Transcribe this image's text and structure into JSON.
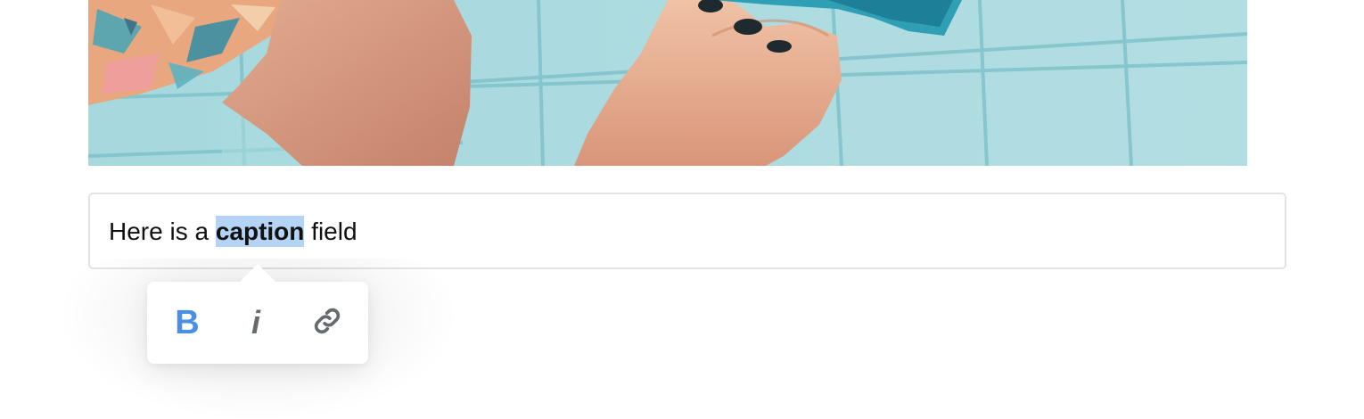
{
  "caption": {
    "before": "Here is a ",
    "selected": "caption",
    "after": " field"
  },
  "toolbar": {
    "bold_label": "B",
    "italic_label": "i",
    "link_icon": "link-icon",
    "active_color": "#4a90e2",
    "inactive_color": "#666b70"
  },
  "colors": {
    "selection_highlight": "#b4d3f5",
    "pool_water": "#a9dadf",
    "field_border": "#e3e3e3"
  }
}
